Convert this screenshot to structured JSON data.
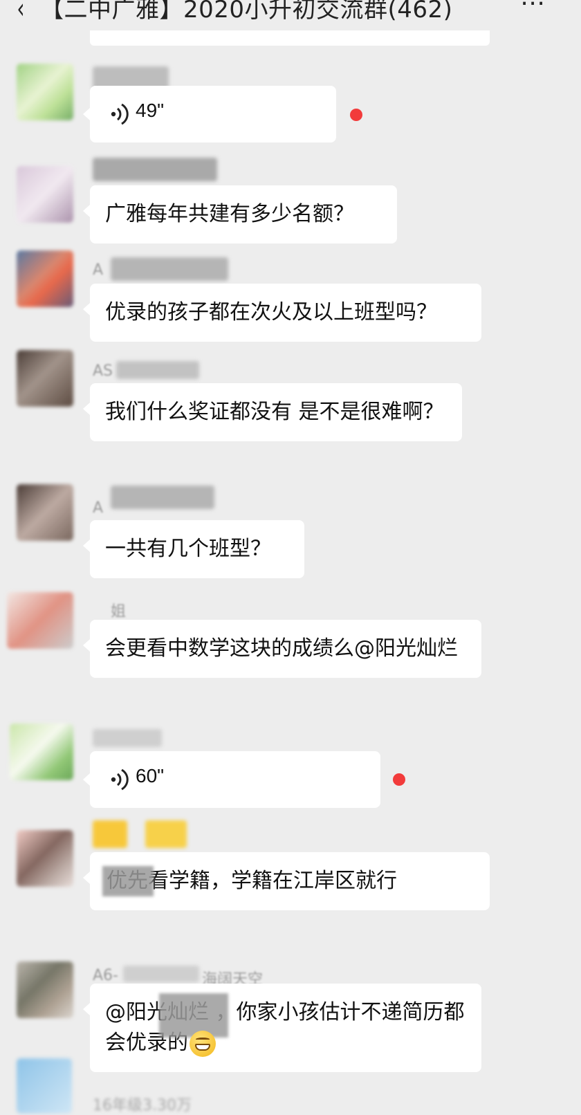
{
  "header": {
    "back_icon": "‹",
    "title": "【二中广雅】2020小升初交流群(462)",
    "more_icon": "⋯"
  },
  "messages": [
    {
      "type": "voice",
      "duration": "49\"",
      "unread": true
    },
    {
      "type": "text",
      "text": "广雅每年共建有多少名额？"
    },
    {
      "type": "text",
      "name_fragment": "A",
      "text": "优录的孩子都在次火及以上班型吗？"
    },
    {
      "type": "text",
      "name_fragment": "AS",
      "text": "我们什么奖证都没有 是不是很难啊？"
    },
    {
      "type": "text",
      "name_fragment": "A",
      "text": "一共有几个班型？"
    },
    {
      "type": "text",
      "name_fragment": "姐",
      "text": "会更看中数学这块的成绩么@阳光灿烂"
    },
    {
      "type": "voice",
      "duration": "60\"",
      "unread": true
    },
    {
      "type": "text",
      "text": "优先看学籍，学籍在江岸区就行"
    },
    {
      "type": "text",
      "name_fragment": "A6-",
      "name_fragment2": "海阔天空",
      "text": "@阳光灿烂 ，你家小孩估计不递简历都会优录的"
    }
  ],
  "bottom_name_fragment": "16年级3.30万"
}
